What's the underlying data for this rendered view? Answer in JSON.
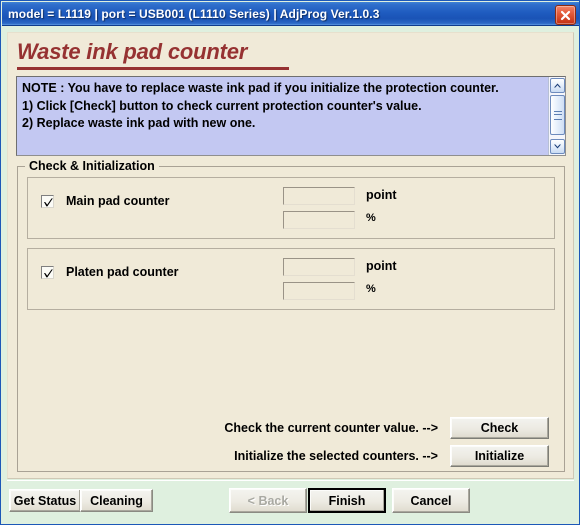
{
  "window": {
    "title": "model = L1119  |  port = USB001 (L1110 Series)  |  AdjProg Ver.1.0.3",
    "close_label": "close-window",
    "accent_titlebar": "#1f5cc0",
    "accent_close": "#c32f12",
    "panel_bg": "#f0ead8",
    "body_bg": "#dff0df"
  },
  "page": {
    "title": "Waste ink pad counter",
    "title_color": "#963232"
  },
  "note": {
    "text": "NOTE : You have to replace waste ink pad if you initialize the protection counter.\n1) Click [Check] button to check current protection counter's value.\n2) Replace waste ink pad with new one.",
    "bg": "#c3c8f2",
    "scroll_up": "scroll-up",
    "scroll_down": "scroll-down"
  },
  "group": {
    "legend": "Check & Initialization",
    "counters": [
      {
        "label": "Main pad counter",
        "checked": true,
        "point_value": "",
        "point_unit": "point",
        "percent_value": "",
        "percent_unit": "%"
      },
      {
        "label": "Platen pad counter",
        "checked": true,
        "point_value": "",
        "point_unit": "point",
        "percent_value": "",
        "percent_unit": "%"
      }
    ],
    "actions": [
      {
        "text": "Check the current counter value. -->",
        "button": "Check"
      },
      {
        "text": "Initialize the selected counters. -->",
        "button": "Initialize"
      }
    ]
  },
  "footer": {
    "get_status": "Get Status",
    "cleaning": "Cleaning",
    "back": "< Back",
    "finish": "Finish",
    "cancel": "Cancel"
  }
}
